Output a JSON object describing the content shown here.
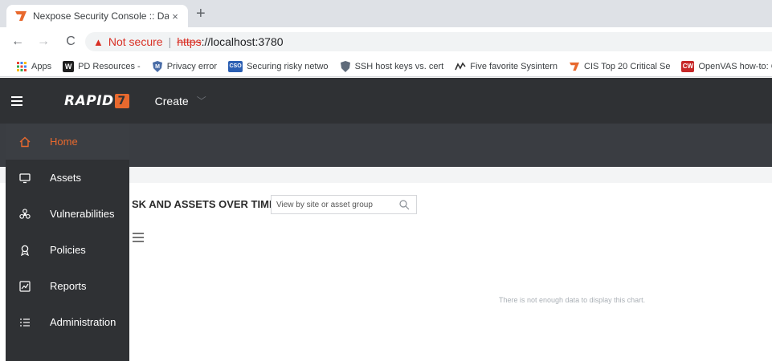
{
  "browser": {
    "tab": {
      "title": "Nexpose Security Console :: Dash",
      "close": "×"
    },
    "new_tab": "+",
    "nav": {
      "back": "←",
      "forward": "→",
      "reload": "C"
    },
    "omnibox": {
      "warning": "▲",
      "security_label": "Not secure",
      "separator": "|",
      "scheme": "https",
      "host": "://localhost:3780"
    },
    "bookmarks": [
      {
        "label": "Apps",
        "icon": "apps-grid-icon"
      },
      {
        "label": "PD Resources -",
        "icon": "w-icon"
      },
      {
        "label": "Privacy error",
        "icon": "shield-m-icon"
      },
      {
        "label": "Securing risky netwo",
        "icon": "cso-icon"
      },
      {
        "label": "SSH host keys vs. cert",
        "icon": "shield-icon"
      },
      {
        "label": "Five favorite Sysintern",
        "icon": "wave-icon"
      },
      {
        "label": "CIS Top 20 Critical Se",
        "icon": "rapid7-icon"
      },
      {
        "label": "OpenVAS how-to: C",
        "icon": "cw-icon"
      }
    ]
  },
  "app": {
    "logo": "RAPID",
    "logo_mark": "7",
    "create_label": "Create",
    "create_chevron": "﹀",
    "accent": "#e8692e"
  },
  "sidenav": {
    "items": [
      {
        "label": "Home",
        "icon": "home-icon",
        "active": true
      },
      {
        "label": "Assets",
        "icon": "monitor-icon"
      },
      {
        "label": "Vulnerabilities",
        "icon": "biohazard-icon"
      },
      {
        "label": "Policies",
        "icon": "ribbon-icon"
      },
      {
        "label": "Reports",
        "icon": "chart-icon"
      },
      {
        "label": "Administration",
        "icon": "list-icon"
      }
    ]
  },
  "dashboard": {
    "card_title": "SK AND ASSETS OVER TIME",
    "site_search_placeholder": "View by site or asset group",
    "no_data_message": "There is not enough data to display this chart."
  }
}
